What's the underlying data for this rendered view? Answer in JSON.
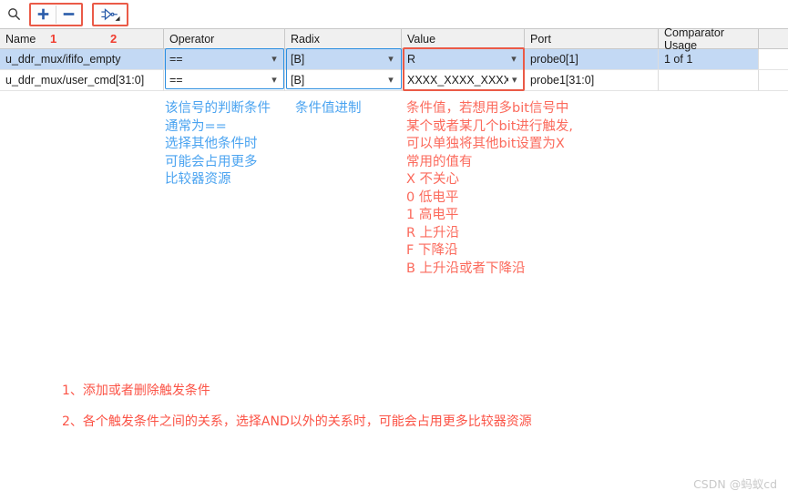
{
  "toolbar": {
    "search_icon": "search-icon",
    "add_label": "+",
    "remove_label": "−",
    "gate_icon": "logic-gate-icon",
    "marker_1": "1",
    "marker_2": "2"
  },
  "table": {
    "columns": [
      {
        "key": "name",
        "label": "Name"
      },
      {
        "key": "operator",
        "label": "Operator"
      },
      {
        "key": "radix",
        "label": "Radix"
      },
      {
        "key": "value",
        "label": "Value"
      },
      {
        "key": "port",
        "label": "Port"
      },
      {
        "key": "comparator",
        "label": "Comparator Usage"
      }
    ],
    "rows": [
      {
        "name": "u_ddr_mux/ififo_empty",
        "operator": "==",
        "radix": "[B]",
        "value": "R",
        "port": "probe0[1]",
        "comparator": "1 of 1",
        "selected": true
      },
      {
        "name": "u_ddr_mux/user_cmd[31:0]",
        "operator": "==",
        "radix": "[B]",
        "value": "XXXX_XXXX_XXXX...",
        "port": "probe1[31:0]",
        "comparator": "",
        "selected": false
      }
    ]
  },
  "annotations": {
    "operator_note": "该信号的判断条件\n通常为==\n选择其他条件时\n可能会占用更多\n比较器资源",
    "radix_note": "条件值进制",
    "value_note": "条件值，若想用多bit信号中\n某个或者某几个bit进行触发,\n可以单独将其他bit设置为X\n常用的值有\nX 不关心\n0 低电平\n1 高电平\nR 上升沿\nF 下降沿\nB 上升沿或者下降沿",
    "bottom_note_1": "1、添加或者删除触发条件",
    "bottom_note_2": "2、各个触发条件之间的关系，选择AND以外的关系时，可能会占用更多比较器资源"
  },
  "watermark": "CSDN @蚂蚁cd",
  "colors": {
    "accent_red": "#ea5a47",
    "accent_blue": "#2d8fe0",
    "row_selected": "#c3d9f4",
    "anno_blue": "#4aa3f0",
    "anno_red": "#fb6a5c"
  }
}
